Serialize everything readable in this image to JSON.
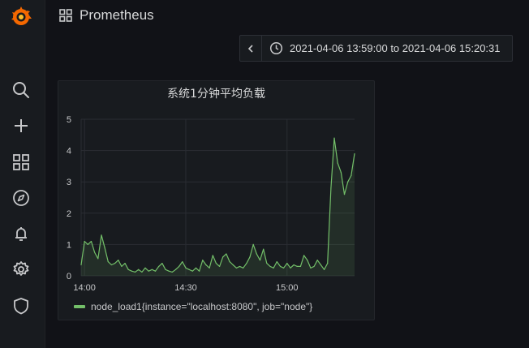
{
  "app": {
    "title": "Prometheus",
    "accent_color": "#f46800",
    "logo_icon": "grafana-logo-icon"
  },
  "sidebar": {
    "items": [
      {
        "icon": "search-icon",
        "label": "Search"
      },
      {
        "icon": "plus-icon",
        "label": "Create"
      },
      {
        "icon": "dashboards-grid-icon",
        "label": "Dashboards"
      },
      {
        "icon": "compass-icon",
        "label": "Explore"
      },
      {
        "icon": "bell-icon",
        "label": "Alerting"
      },
      {
        "icon": "gear-icon",
        "label": "Configuration"
      },
      {
        "icon": "shield-icon",
        "label": "Server Admin"
      }
    ]
  },
  "time_picker": {
    "back_icon": "chevron-left-icon",
    "clock_icon": "clock-icon",
    "range_text": "2021-04-06 13:59:00 to 2021-04-06 15:20:31"
  },
  "panel": {
    "title": "系统1分钟平均负载"
  },
  "chart_data": {
    "type": "line",
    "title": "系统1分钟平均负载",
    "xlabel": "",
    "ylabel": "",
    "xlim": [
      "13:59",
      "15:20"
    ],
    "ylim": [
      0,
      5
    ],
    "y_ticks": [
      "0",
      "1",
      "2",
      "3",
      "4",
      "5"
    ],
    "x_ticks": [
      {
        "t": "14:00",
        "label": "14:00"
      },
      {
        "t": "14:30",
        "label": "14:30"
      },
      {
        "t": "15:00",
        "label": "15:00"
      }
    ],
    "grid": true,
    "legend_position": "bottom-left",
    "series": [
      {
        "name": "node_load1{instance=\"localhost:8080\", job=\"node\"}",
        "color": "#73bf69",
        "fill": true,
        "points": [
          [
            "13:59",
            0.35
          ],
          [
            "14:00",
            1.1
          ],
          [
            "14:01",
            1.0
          ],
          [
            "14:02",
            1.1
          ],
          [
            "14:03",
            0.75
          ],
          [
            "14:04",
            0.55
          ],
          [
            "14:05",
            1.3
          ],
          [
            "14:06",
            0.9
          ],
          [
            "14:07",
            0.45
          ],
          [
            "14:08",
            0.35
          ],
          [
            "14:09",
            0.4
          ],
          [
            "14:10",
            0.5
          ],
          [
            "14:11",
            0.3
          ],
          [
            "14:12",
            0.4
          ],
          [
            "14:13",
            0.2
          ],
          [
            "14:14",
            0.15
          ],
          [
            "14:15",
            0.12
          ],
          [
            "14:16",
            0.2
          ],
          [
            "14:17",
            0.12
          ],
          [
            "14:18",
            0.25
          ],
          [
            "14:19",
            0.15
          ],
          [
            "14:20",
            0.2
          ],
          [
            "14:21",
            0.15
          ],
          [
            "14:22",
            0.3
          ],
          [
            "14:23",
            0.4
          ],
          [
            "14:24",
            0.2
          ],
          [
            "14:25",
            0.15
          ],
          [
            "14:26",
            0.12
          ],
          [
            "14:27",
            0.2
          ],
          [
            "14:28",
            0.3
          ],
          [
            "14:29",
            0.45
          ],
          [
            "14:30",
            0.25
          ],
          [
            "14:31",
            0.2
          ],
          [
            "14:32",
            0.15
          ],
          [
            "14:33",
            0.25
          ],
          [
            "14:34",
            0.15
          ],
          [
            "14:35",
            0.5
          ],
          [
            "14:36",
            0.35
          ],
          [
            "14:37",
            0.25
          ],
          [
            "14:38",
            0.65
          ],
          [
            "14:39",
            0.4
          ],
          [
            "14:40",
            0.3
          ],
          [
            "14:41",
            0.6
          ],
          [
            "14:42",
            0.7
          ],
          [
            "14:43",
            0.45
          ],
          [
            "14:44",
            0.35
          ],
          [
            "14:45",
            0.25
          ],
          [
            "14:46",
            0.3
          ],
          [
            "14:47",
            0.25
          ],
          [
            "14:48",
            0.4
          ],
          [
            "14:49",
            0.6
          ],
          [
            "14:50",
            1.0
          ],
          [
            "14:51",
            0.7
          ],
          [
            "14:52",
            0.5
          ],
          [
            "14:53",
            0.85
          ],
          [
            "14:54",
            0.4
          ],
          [
            "14:55",
            0.3
          ],
          [
            "14:56",
            0.25
          ],
          [
            "14:57",
            0.45
          ],
          [
            "14:58",
            0.3
          ],
          [
            "14:59",
            0.25
          ],
          [
            "15:00",
            0.4
          ],
          [
            "15:01",
            0.25
          ],
          [
            "15:02",
            0.35
          ],
          [
            "15:03",
            0.3
          ],
          [
            "15:04",
            0.3
          ],
          [
            "15:05",
            0.65
          ],
          [
            "15:06",
            0.5
          ],
          [
            "15:07",
            0.25
          ],
          [
            "15:08",
            0.3
          ],
          [
            "15:09",
            0.5
          ],
          [
            "15:10",
            0.35
          ],
          [
            "15:11",
            0.2
          ],
          [
            "15:12",
            0.4
          ],
          [
            "15:13",
            2.8
          ],
          [
            "15:14",
            4.4
          ],
          [
            "15:15",
            3.6
          ],
          [
            "15:16",
            3.3
          ],
          [
            "15:17",
            2.6
          ],
          [
            "15:18",
            3.0
          ],
          [
            "15:19",
            3.2
          ],
          [
            "15:20",
            3.9
          ]
        ]
      }
    ]
  }
}
